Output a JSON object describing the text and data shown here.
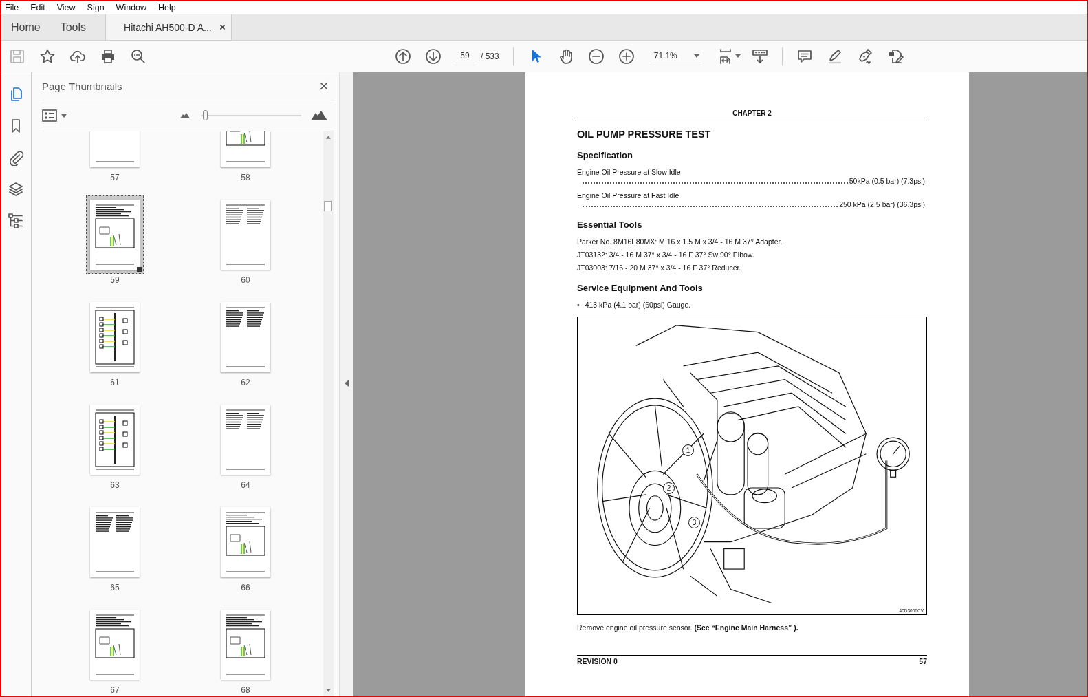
{
  "menu": [
    "File",
    "Edit",
    "View",
    "Sign",
    "Window",
    "Help"
  ],
  "tabs": [
    {
      "label": "Home",
      "kind": "nav",
      "selected": false
    },
    {
      "label": "Tools",
      "kind": "nav",
      "selected": false
    },
    {
      "label": "Hitachi AH500-D A...",
      "kind": "document",
      "selected": true
    }
  ],
  "toolbar": {
    "file_tools": [
      {
        "kind": "save",
        "disabled": true
      },
      {
        "kind": "bookmark",
        "disabled": false
      },
      {
        "kind": "upload",
        "disabled": false
      },
      {
        "kind": "print",
        "disabled": false
      },
      {
        "kind": "find",
        "disabled": false
      }
    ],
    "page_nav": {
      "current": "59",
      "total": "/ 533"
    },
    "pointer_tools": [
      {
        "kind": "select",
        "selected": true
      },
      {
        "kind": "hand",
        "selected": false
      }
    ],
    "zoom": {
      "value": "71.1%"
    },
    "annotate_tools": [
      {
        "kind": "comment"
      },
      {
        "kind": "highlight"
      },
      {
        "kind": "sign"
      },
      {
        "kind": "edit"
      }
    ]
  },
  "side_tools": [
    {
      "kind": "pages",
      "selected": true
    },
    {
      "kind": "bookmarks",
      "selected": false
    },
    {
      "kind": "attachments",
      "selected": false
    },
    {
      "kind": "layers",
      "selected": false
    },
    {
      "kind": "structure",
      "selected": false
    }
  ],
  "panel": {
    "title": "Page Thumbnails",
    "slider": {
      "level": 0.02
    },
    "thumbnails": [
      {
        "label": "57",
        "kind": "text",
        "selected": false
      },
      {
        "label": "58",
        "kind": "figure",
        "selected": false
      },
      {
        "label": "59",
        "kind": "figure",
        "selected": true
      },
      {
        "label": "60",
        "kind": "text",
        "selected": false
      },
      {
        "label": "61",
        "kind": "diagram",
        "selected": false
      },
      {
        "label": "62",
        "kind": "text",
        "selected": false
      },
      {
        "label": "63",
        "kind": "diagram",
        "selected": false
      },
      {
        "label": "64",
        "kind": "text",
        "selected": false
      },
      {
        "label": "65",
        "kind": "text",
        "selected": false
      },
      {
        "label": "66",
        "kind": "figure",
        "selected": false
      },
      {
        "label": "67",
        "kind": "figure",
        "selected": false
      },
      {
        "label": "68",
        "kind": "figure",
        "selected": false
      }
    ]
  },
  "document": {
    "header": "CHAPTER 2",
    "title": "OIL PUMP PRESSURE TEST",
    "blocks": [
      {
        "kind": "heading",
        "text": "Specification"
      },
      {
        "kind": "spec",
        "label": "Engine Oil Pressure at Slow Idle",
        "value": "50kPa (0.5 bar) (7.3psi)."
      },
      {
        "kind": "spec",
        "label": "Engine Oil Pressure at Fast Idle",
        "value": "250 kPa (2.5 bar) (36.3psi)."
      },
      {
        "kind": "heading",
        "text": "Essential Tools"
      },
      {
        "kind": "line",
        "text": "Parker No. 8M16F80MX: M 16 x 1.5 M x 3/4 - 16 M 37° Adapter."
      },
      {
        "kind": "line",
        "text": "JT03132: 3/4 - 16 M 37° x 3/4 - 16 F 37° Sw 90° Elbow."
      },
      {
        "kind": "line",
        "text": "JT03003: 7/16 - 20 M 37° x 3/4 - 16 F 37° Reducer."
      },
      {
        "kind": "heading",
        "text": "Service Equipment And Tools"
      },
      {
        "kind": "bullet",
        "mark": "•",
        "text": "413 kPa (4.1 bar) (60psi) Gauge."
      },
      {
        "kind": "figure",
        "callouts": [
          "1",
          "2",
          "3"
        ],
        "figure_id": "40D3006CV"
      },
      {
        "kind": "line",
        "text": "Remove engine oil pressure sensor. **(See “Engine Main Harness” ).**"
      }
    ],
    "footer": {
      "revision": "REVISION 0",
      "page": "57"
    }
  }
}
